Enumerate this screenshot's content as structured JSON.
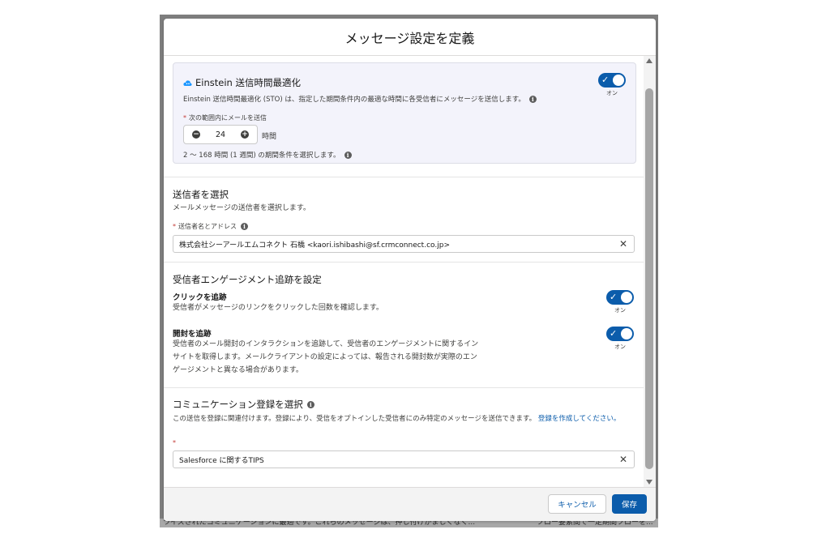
{
  "modal": {
    "title": "メッセージ設定を定義"
  },
  "einstein": {
    "title": "Einstein 送信時間最適化",
    "description": "Einstein 送信時間最適化 (STO) は、指定した期間条件内の最適な時間に各受信者にメッセージを送信します。",
    "toggle_label": "オン",
    "send_window_label": "次の範囲内にメールを送信",
    "hours_value": "24",
    "hours_unit": "時間",
    "range_help": "2 〜 168 時間 (1 週間) の期間条件を選択します。",
    "accent_color": "#0b5cab"
  },
  "sender": {
    "title": "送信者を選択",
    "subtitle": "メールメッセージの送信者を選択します。",
    "field_label": "送信者名とアドレス",
    "value": "株式会社シーアールエムコネクト 石橋 <kaori.ishibashi@sf.crmconnect.co.jp>"
  },
  "engagement": {
    "title": "受信者エンゲージメント追跡を設定",
    "click_tracking": {
      "title": "クリックを追跡",
      "description": "受信者がメッセージのリンクをクリックした回数を確認します。",
      "toggle_label": "オン"
    },
    "open_tracking": {
      "title": "開封を追跡",
      "description": "受信者のメール開封のインタラクションを追跡して、受信者のエンゲージメントに関するインサイトを取得します。メールクライアントの設定によっては、報告される開封数が実際のエンゲージメントと異なる場合があります。",
      "toggle_label": "オン"
    }
  },
  "communication": {
    "title": "コミュニケーション登録を選択",
    "description": "この送信を登録に関連付けます。登録により、受信をオプトインした受信者にのみ特定のメッセージを送信できます。",
    "link_text": "登録を作成してください。",
    "value": "Salesforce に関するTIPS"
  },
  "footer": {
    "cancel_label": "キャンセル",
    "save_label": "保存"
  },
  "background": {
    "strip_text_left": "ライズされたコミュニケーションに最適です。これらのメッセージは、押し付けがましくなく...",
    "strip_text_right": "フロー要素間で一定期間フローを..."
  },
  "icons": {
    "einstein": "cloud-icon",
    "info": "info-icon",
    "clear": "close-icon",
    "decrement": "minus-icon",
    "increment": "plus-icon",
    "toggle_on": "check-icon"
  }
}
